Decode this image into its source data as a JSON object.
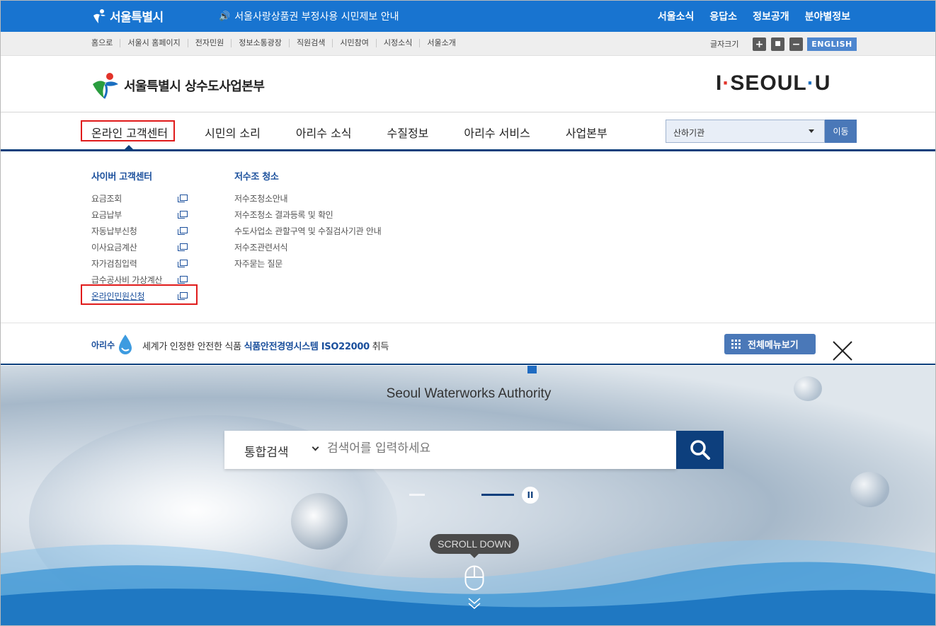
{
  "topbar": {
    "logo": "서울특별시",
    "notice": "서울사랑상품권 부정사용 시민제보 안내",
    "links": [
      "서울소식",
      "응답소",
      "정보공개",
      "분야별정보"
    ]
  },
  "utilbar": {
    "links": [
      "홈으로",
      "서울시 홈페이지",
      "전자민원",
      "정보소통광장",
      "직원검색",
      "시민참여",
      "시정소식",
      "서울소개"
    ],
    "font_size_label": "글자크기",
    "plus": "+",
    "reset": "■",
    "minus": "−",
    "english": "ENGLISH"
  },
  "header": {
    "brand": "서울특별시 상수도사업본부",
    "slogan": {
      "i": "I",
      "seoul": "SEOUL",
      "u": "U"
    }
  },
  "gnb": {
    "items": [
      "온라인 고객센터",
      "시민의 소리",
      "아리수 소식",
      "수질정보",
      "아리수 서비스",
      "사업본부"
    ],
    "select_value": "산하기관",
    "go_label": "이동"
  },
  "dropdown": {
    "col1": {
      "title": "사이버 고객센터",
      "items": [
        "요금조회",
        "요금납부",
        "자동납부신청",
        "이사요금계산",
        "자가검침입력",
        "급수공사비 가상계산",
        "온라인민원신청"
      ]
    },
    "col2": {
      "title": "저수조 청소",
      "items": [
        "저수조청소안내",
        "저수조청소 결과등록 및 확인",
        "수도사업소 관할구역 및 수질검사기관 안내",
        "저수조관련서식",
        "자주묻는 질문"
      ]
    }
  },
  "strip": {
    "arisu_logo": "아리수",
    "message_prefix": "세계가 인정한 안전한 식품 ",
    "message_bold": "식품안전경영시스템 ISO22000",
    "message_suffix": " 취득",
    "all_menu": "전체메뉴보기"
  },
  "hero": {
    "title": "Seoul Waterworks Authority",
    "search_category": "통합검색",
    "search_placeholder": "검색어를 입력하세요",
    "pause": "II",
    "scroll_label": "SCROLL DOWN"
  },
  "colors": {
    "primary_blue": "#1874d0",
    "navy": "#0c3f7c",
    "highlight_red": "#e01b1b",
    "button_blue": "#4a78b8"
  }
}
